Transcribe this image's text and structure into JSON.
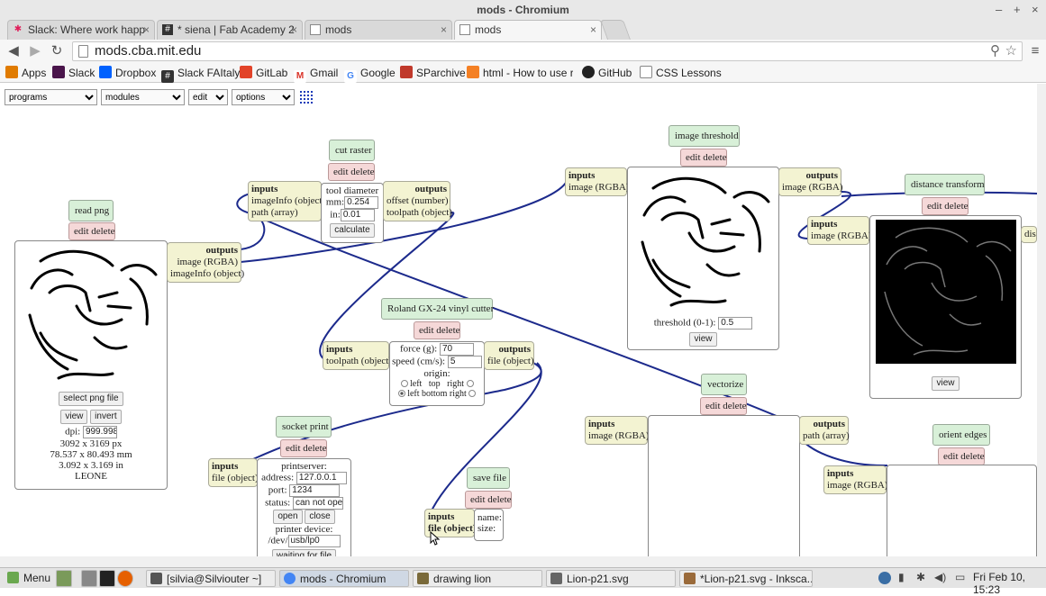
{
  "window": {
    "title": "mods - Chromium",
    "controls": [
      "–",
      "+",
      "×"
    ]
  },
  "tabs": [
    {
      "label": "Slack: Where work happ",
      "icon": "slack-icon"
    },
    {
      "label": "* siena | Fab Academy 2",
      "icon": "hash-icon"
    },
    {
      "label": "mods",
      "icon": "page-icon"
    },
    {
      "label": "mods",
      "icon": "page-icon",
      "active": true
    }
  ],
  "toolbar": {
    "url": "mods.cba.mit.edu"
  },
  "bookmarks": [
    {
      "label": "Apps",
      "color": "#e07b00"
    },
    {
      "label": "Slack",
      "color": "#4a154b"
    },
    {
      "label": "Dropbox",
      "color": "#0061fe"
    },
    {
      "label": "Slack FAItaly",
      "color": "#333333"
    },
    {
      "label": "GitLab",
      "color": "#e24329"
    },
    {
      "label": "Gmail",
      "color": "#d93025"
    },
    {
      "label": "Google",
      "color": "#4285f4"
    },
    {
      "label": "SParchive",
      "color": "#c0392b"
    },
    {
      "label": "html - How to use re",
      "color": "#f48024"
    },
    {
      "label": "GitHub",
      "color": "#222222"
    },
    {
      "label": "CSS Lessons",
      "color": "#888888"
    }
  ],
  "menus": [
    "programs",
    "modules",
    "edit",
    "options"
  ],
  "modules": {
    "read_png": {
      "title": "read png",
      "edit_delete": "edit delete",
      "outputs": "outputs",
      "out1": "image (RGBA)",
      "out2": "imageInfo (object)",
      "select": "select png file",
      "view": "view",
      "invert": "invert",
      "dpi_label": "dpi:",
      "dpi": "999.998",
      "px": "3092 x 3169 px",
      "mm": "78.537 x 80.493 mm",
      "in": "3.092 x 3.169 in",
      "name": "LEONE"
    },
    "cut_raster": {
      "title": "cut raster",
      "edit_delete": "edit delete",
      "inputs": "inputs",
      "in1": "imageInfo (object)",
      "in2": "path (array)",
      "tool_diameter": "tool diameter",
      "mm_label": "mm:",
      "mm": "0.254",
      "in_label": "in:",
      "in": "0.01",
      "calculate": "calculate",
      "outputs": "outputs",
      "out1": "offset (number)",
      "out2": "toolpath (object)"
    },
    "image_threshold": {
      "title": "image threshold",
      "edit_delete": "edit delete",
      "inputs": "inputs",
      "in1": "image (RGBA)",
      "threshold_label": "threshold (0-1):",
      "threshold": "0.5",
      "view": "view",
      "outputs": "outputs",
      "out1": "image (RGBA)"
    },
    "distance_transform": {
      "title": "distance transform",
      "edit_delete": "edit delete",
      "inputs": "inputs",
      "in1": "image (RGBA)",
      "view": "view",
      "partial": "dis"
    },
    "roland": {
      "title": "Roland GX-24 vinyl cutter",
      "edit_delete": "edit delete",
      "inputs": "inputs",
      "in1": "toolpath (object)",
      "force_label": "force (g):",
      "force": "70",
      "speed_label": "speed (cm/s):",
      "speed": "5",
      "origin": "origin:",
      "left": "left",
      "top": "top",
      "right": "right",
      "left_bottom_right": "left bottom right",
      "outputs": "outputs",
      "out1": "file (object)"
    },
    "vectorize": {
      "title": "vectorize",
      "edit_delete": "edit delete",
      "inputs": "inputs",
      "in1": "image (RGBA)",
      "outputs": "outputs",
      "out1": "path (array)"
    },
    "orient_edges": {
      "title": "orient edges",
      "edit_delete": "edit delete",
      "inputs": "inputs",
      "in1": "image (RGBA)"
    },
    "socket_print": {
      "title": "socket print",
      "edit_delete": "edit delete",
      "inputs": "inputs",
      "in1": "file (object)",
      "printserver": "printserver:",
      "address_label": "address:",
      "address": "127.0.0.1",
      "port_label": "port:",
      "port": "1234",
      "status_label": "status:",
      "status": "can not open s",
      "open": "open",
      "close": "close",
      "printer_device": "printer device:",
      "dev_label": "/dev/",
      "dev": "usb/lp0",
      "waiting": "waiting for file"
    },
    "save_file": {
      "title": "save file",
      "edit_delete": "edit delete",
      "inputs": "inputs",
      "in1": "file (object)",
      "name_label": "name:",
      "size_label": "size:"
    }
  },
  "taskbar": {
    "menu": "Menu",
    "items": [
      {
        "label": "[silvia@Silviouter ~]",
        "color": "#555555"
      },
      {
        "label": "mods - Chromium",
        "color": "#4285f4",
        "active": true
      },
      {
        "label": "drawing lion",
        "color": "#7a6a3a"
      },
      {
        "label": "Lion-p21.svg",
        "color": "#666666"
      },
      {
        "label": "*Lion-p21.svg - Inksca...",
        "color": "#9a6a3a"
      }
    ],
    "clock": "Fri Feb 10, 15:23"
  }
}
